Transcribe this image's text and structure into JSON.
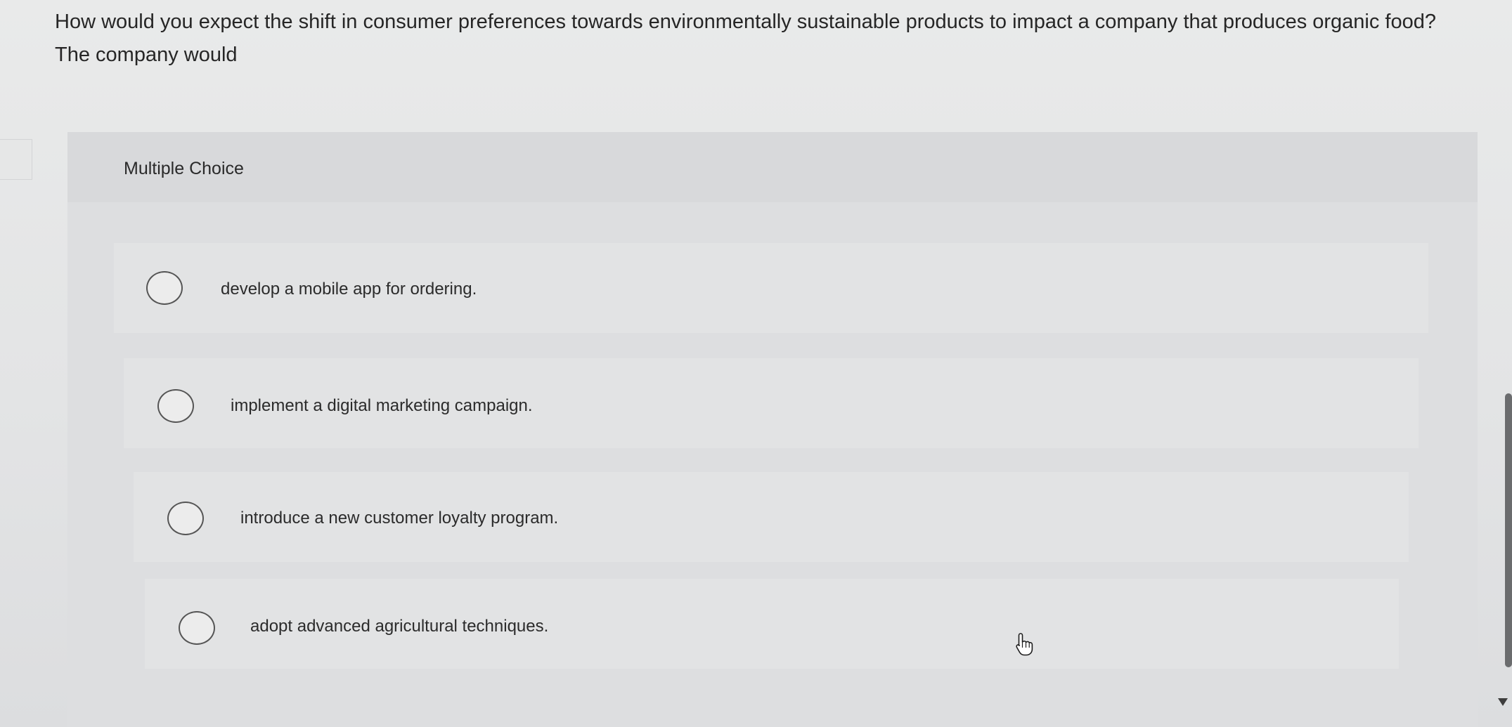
{
  "question": {
    "line1": "How would you expect the shift in consumer preferences towards environmentally sustainable products to impact a company that produces organic food?",
    "line2": "The company would"
  },
  "multiple_choice": {
    "label": "Multiple Choice",
    "options": [
      {
        "text": "develop a mobile app for ordering.",
        "selected": false
      },
      {
        "text": "implement a digital marketing campaign.",
        "selected": false
      },
      {
        "text": "introduce a new customer loyalty program.",
        "selected": false
      },
      {
        "text": "adopt advanced agricultural techniques.",
        "selected": false
      }
    ]
  },
  "icons": {
    "radio": "radio-empty-icon",
    "cursor": "hand-pointer-icon",
    "scroll": "scroll-down-arrow-icon"
  },
  "colors": {
    "background": "#e7e8e8",
    "panel": "#dddee0",
    "option": "#e2e3e4",
    "text": "#262626"
  }
}
